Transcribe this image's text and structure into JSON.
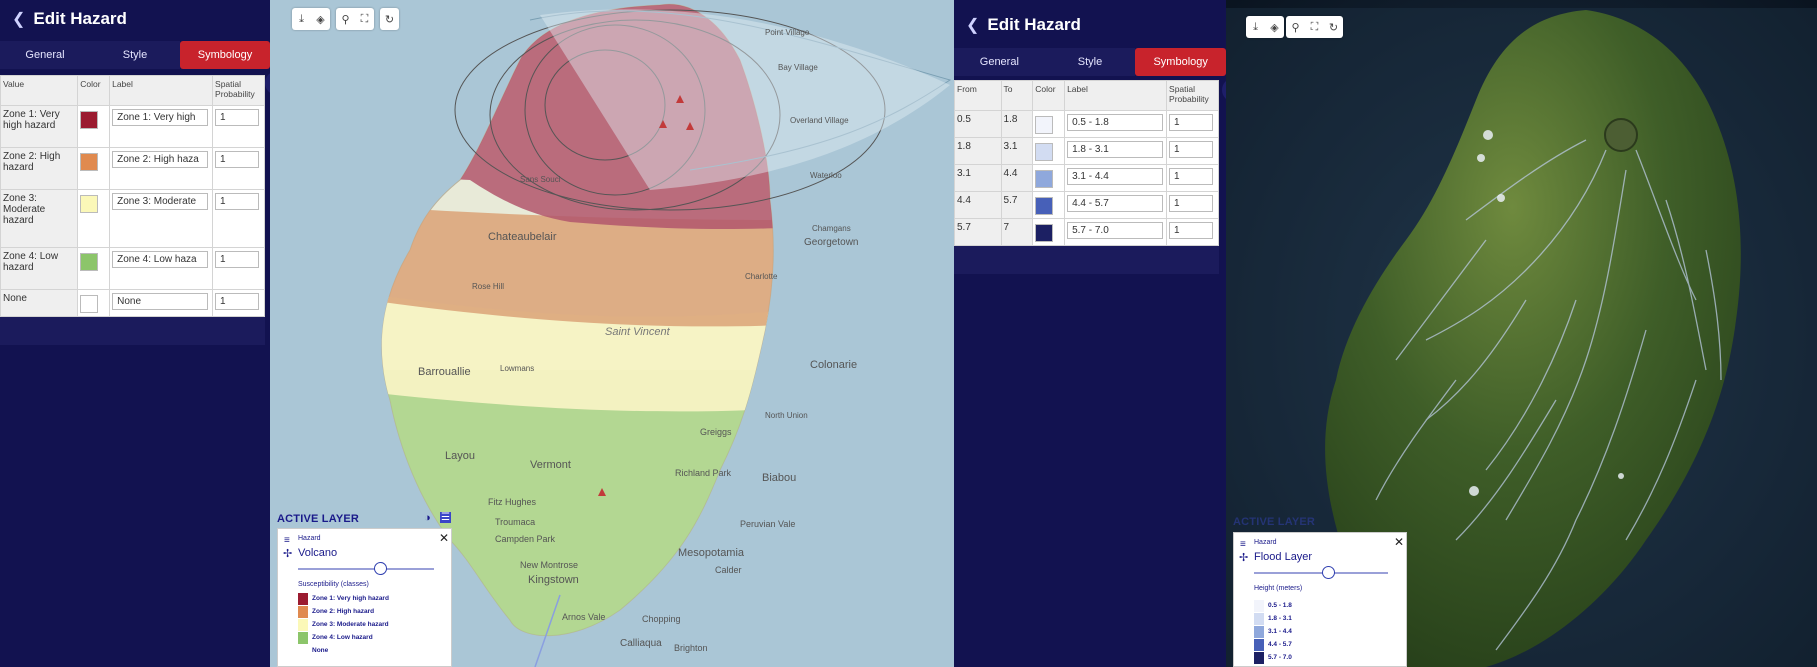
{
  "left_panel": {
    "title": "Edit Hazard",
    "tabs": [
      "General",
      "Style",
      "Symbology"
    ],
    "table": {
      "headers": [
        "Value",
        "Color",
        "Label",
        "Spatial Probability"
      ],
      "rows": [
        {
          "value": "Zone 1: Very high hazard",
          "color": "#9b1b30",
          "label": "Zone 1: Very high",
          "prob": "1"
        },
        {
          "value": "Zone 2: High hazard",
          "color": "#e08a4f",
          "label": "Zone 2: High haza",
          "prob": "1"
        },
        {
          "value": "Zone 3: Moderate hazard",
          "color": "#fbf8b8",
          "label": "Zone 3: Moderate",
          "prob": "1"
        },
        {
          "value": "Zone 4: Low hazard",
          "color": "#8cc56a",
          "label": "Zone 4: Low haza",
          "prob": "1"
        },
        {
          "value": "None",
          "color": "#ffffff",
          "label": "None",
          "prob": "1"
        }
      ]
    }
  },
  "right_panel": {
    "title": "Edit Hazard",
    "tabs": [
      "General",
      "Style",
      "Symbology"
    ],
    "table": {
      "headers": [
        "From",
        "To",
        "Color",
        "Label",
        "Spatial Probability"
      ],
      "rows": [
        {
          "from": "0.5",
          "to": "1.8",
          "color": "#f2f4fb",
          "label": "0.5 - 1.8",
          "prob": "1"
        },
        {
          "from": "1.8",
          "to": "3.1",
          "color": "#d2dcf2",
          "label": "1.8 - 3.1",
          "prob": "1"
        },
        {
          "from": "3.1",
          "to": "4.4",
          "color": "#8fa8dc",
          "label": "3.1 - 4.4",
          "prob": "1"
        },
        {
          "from": "4.4",
          "to": "5.7",
          "color": "#4760b8",
          "label": "4.4 - 5.7",
          "prob": "1"
        },
        {
          "from": "5.7",
          "to": "7",
          "color": "#1c2063",
          "label": "5.7 - 7.0",
          "prob": "1"
        }
      ]
    }
  },
  "volcano_map": {
    "place_labels": [
      "Chateaubelair",
      "Saint Vincent",
      "Barrouallie",
      "Colonarie",
      "Layou",
      "Vermont",
      "Richland Park",
      "Biabou",
      "Mesopotamia",
      "Kingstown",
      "Georgetown",
      "Greiggs",
      "Arnos Vale",
      "Calliaqua",
      "Brighton",
      "Chopping",
      "Calder",
      "Peruvian Vale",
      "Campden Park",
      "New Montrose",
      "Troumaca",
      "Fitz Hughes",
      "Lowmans",
      "Waterloo",
      "Charlotte",
      "North Union",
      "Point Village",
      "Bay Village",
      "Overland Village",
      "Chamgans",
      "Rose Hill",
      "Sans Souci"
    ],
    "active_layer_title": "ACTIVE LAYER",
    "layer": {
      "category": "Hazard",
      "name": "Volcano",
      "opacity": 0.6,
      "legend_title": "Susceptibility (classes)",
      "legend": [
        {
          "label": "Zone 1: Very high hazard",
          "color": "#9b1b30"
        },
        {
          "label": "Zone 2: High hazard",
          "color": "#e08a4f"
        },
        {
          "label": "Zone 3: Moderate hazard",
          "color": "#fbf8b8"
        },
        {
          "label": "Zone 4: Low hazard",
          "color": "#8cc56a"
        },
        {
          "label": "None",
          "color": "#ffffff"
        }
      ]
    }
  },
  "flood_map": {
    "active_layer_title": "ACTIVE LAYER",
    "layer": {
      "category": "Hazard",
      "name": "Flood Layer",
      "opacity": 0.55,
      "legend_title": "Height (meters)",
      "legend": [
        {
          "label": "0.5 - 1.8",
          "color": "#f2f4fb"
        },
        {
          "label": "1.8 - 3.1",
          "color": "#d2dcf2"
        },
        {
          "label": "3.1 - 4.4",
          "color": "#8fa8dc"
        },
        {
          "label": "4.4 - 5.7",
          "color": "#4760b8"
        },
        {
          "label": "5.7 - 7.0",
          "color": "#1c2063"
        }
      ]
    }
  },
  "colors": {
    "accent": "#c8232c",
    "panel_bg": "#121250",
    "ocean": "#aac6d6"
  }
}
